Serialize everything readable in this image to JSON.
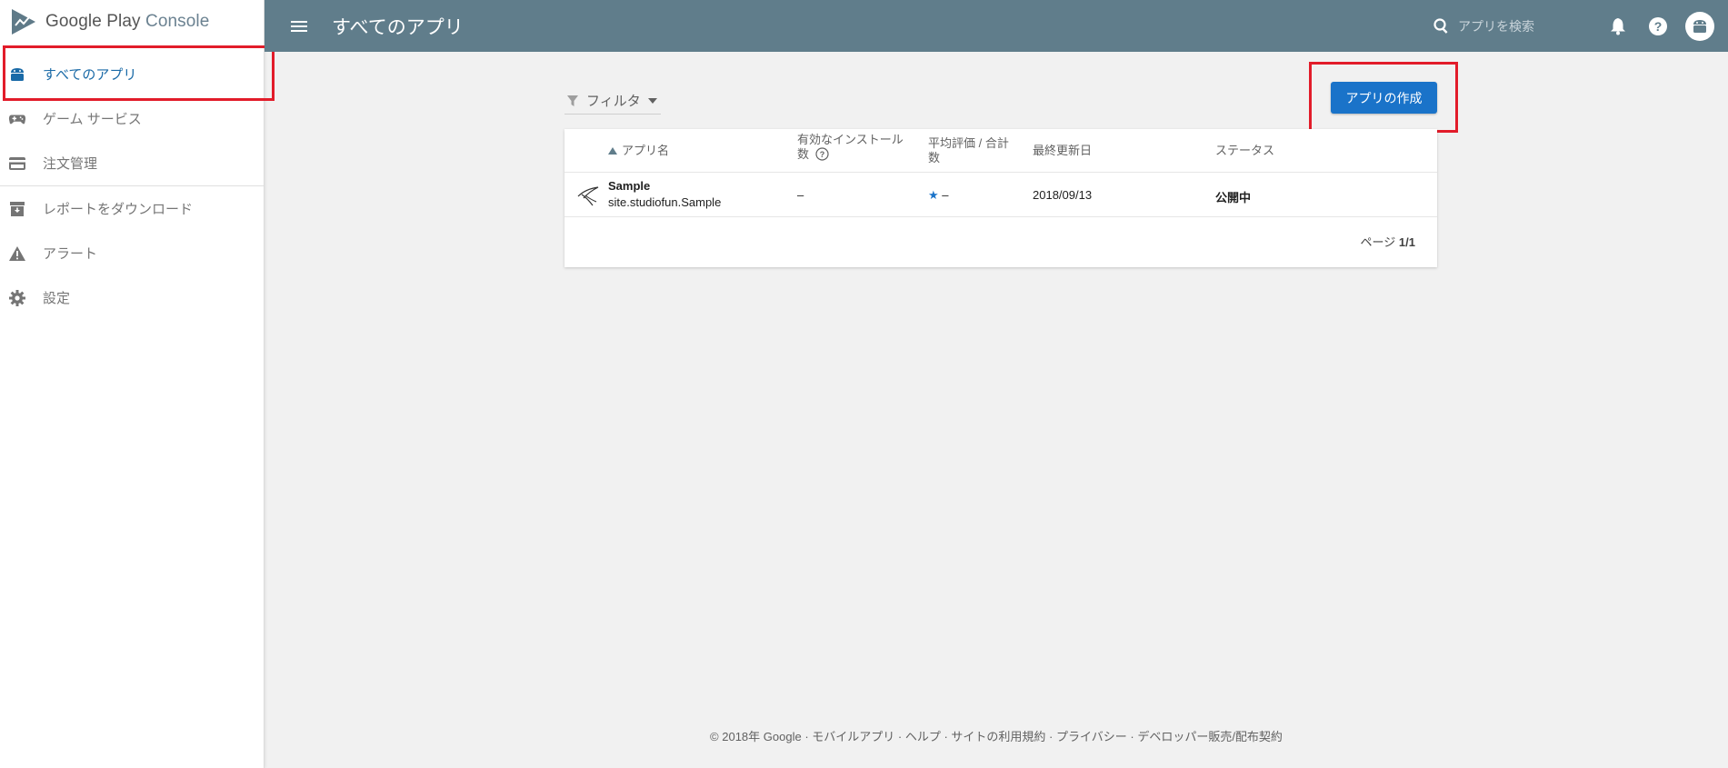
{
  "brand": {
    "name": "Google Play",
    "product": "Console"
  },
  "sidebar": {
    "items": [
      {
        "label": "すべてのアプリ",
        "icon": "android-icon",
        "active": true
      },
      {
        "label": "ゲーム サービス",
        "icon": "gamepad-icon"
      },
      {
        "label": "注文管理",
        "icon": "credit-card-icon"
      },
      {
        "label": "レポートをダウンロード",
        "icon": "download-box-icon"
      },
      {
        "label": "アラート",
        "icon": "warning-icon"
      },
      {
        "label": "設定",
        "icon": "gear-icon"
      }
    ]
  },
  "header": {
    "title": "すべてのアプリ",
    "search_placeholder": "アプリを検索"
  },
  "toolbar": {
    "filter_label": "フィルタ",
    "create_label": "アプリの作成"
  },
  "table": {
    "columns": {
      "name": "アプリ名",
      "installs": "有効なインストール数",
      "rating": "平均評価 / 合計数",
      "updated": "最終更新日",
      "status": "ステータス"
    },
    "rows": [
      {
        "name": "Sample",
        "package": "site.studiofun.Sample",
        "installs": "–",
        "rating": "–",
        "updated": "2018/09/13",
        "status": "公開中"
      }
    ],
    "pager_prefix": "ページ",
    "pager_value": "1/1"
  },
  "footer": {
    "copyright": "© 2018年 Google",
    "links": [
      "モバイルアプリ",
      "ヘルプ",
      "サイトの利用規約",
      "プライバシー",
      "デベロッパー販売/配布契約"
    ]
  },
  "colors": {
    "topbar": "#607d8b",
    "accent": "#1a73c9",
    "active_nav": "#1a6aa7",
    "highlight": "#e21c2a"
  }
}
